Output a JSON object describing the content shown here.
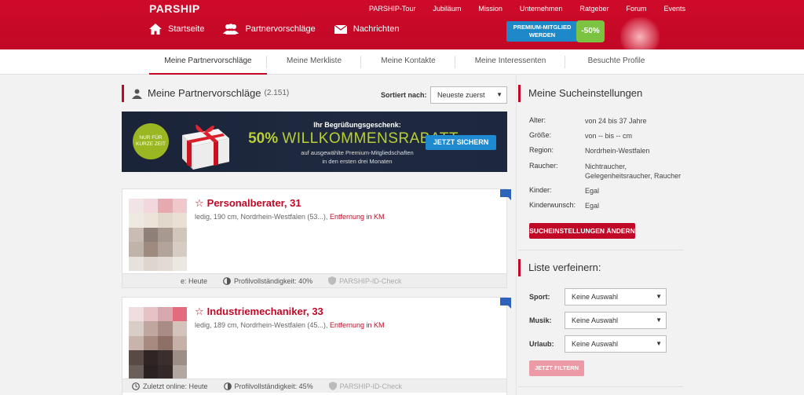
{
  "header": {
    "logo": "PARSHIP",
    "top_links": [
      "PARSHIP-Tour",
      "Jubiläum",
      "Mission",
      "Unternehmen",
      "Ratgeber",
      "Forum",
      "Events"
    ],
    "nav": [
      {
        "label": "Startseite",
        "icon": "home-icon"
      },
      {
        "label": "Partnervorschläge",
        "icon": "people-icon"
      },
      {
        "label": "Nachrichten",
        "icon": "envelope-icon"
      }
    ],
    "premium_line1": "PREMIUM-MITGLIED",
    "premium_line2": "WERDEN",
    "premium_discount": "-50%"
  },
  "subnav": {
    "tabs": [
      "Meine Partnervorschläge",
      "Meine Merkliste",
      "Meine Kontakte",
      "Meine Interessenten",
      "Besuchte Profile"
    ]
  },
  "main": {
    "title": "Meine Partnervorschläge",
    "count": "(2.151)",
    "sort_label": "Sortiert nach:",
    "sort_value": "Neueste zuerst",
    "banner": {
      "badge_line1": "NUR FÜR",
      "badge_line2": "KURZE ZEIT",
      "headline": "Ihr Begrüßungsgeschenk:",
      "percent": "50%",
      "word": "WILLKOMMENSRABATT",
      "sub_line1": "auf ausgewählte Premium-Mitgliedschaften",
      "sub_line2": "in den ersten drei Monaten",
      "button": "JETZT SICHERN"
    },
    "profiles": [
      {
        "name": "Personalberater, 31",
        "details": "ledig, 190 cm, Nordrhein-Westfalen (53...),",
        "distance": "Entfernung in KM",
        "online": "e: Heute",
        "completeness": "Profilvollständigkeit: 40%",
        "id_check": "PARSHIP-ID-Check"
      },
      {
        "name": "Industriemechaniker, 33",
        "details": "ledig, 189 cm, Nordrhein-Westfalen (45...),",
        "distance": "Entfernung in KM",
        "online": "Zuletzt online: Heute",
        "completeness": "Profilvollständigkeit: 45%",
        "id_check": "PARSHIP-ID-Check"
      }
    ]
  },
  "sidebar": {
    "search_title": "Meine Sucheinstellungen",
    "settings": [
      {
        "key": "Alter:",
        "value": "von 24 bis 37 Jahre"
      },
      {
        "key": "Größe:",
        "value": "von -- bis -- cm"
      },
      {
        "key": "Region:",
        "value": "Nordrhein-Westfalen"
      },
      {
        "key": "Raucher:",
        "value": "Nichtraucher, Gelegenheitsraucher, Raucher"
      },
      {
        "key": "Kinder:",
        "value": "Egal"
      },
      {
        "key": "Kinderwunsch:",
        "value": "Egal"
      }
    ],
    "change_button": "SUCHEINSTELLUNGEN ÄNDERN",
    "refine_title": "Liste verfeinern:",
    "filters": [
      {
        "label": "Sport:",
        "value": "Keine Auswahl"
      },
      {
        "label": "Musik:",
        "value": "Keine Auswahl"
      },
      {
        "label": "Urlaub:",
        "value": "Keine Auswahl"
      }
    ],
    "filter_button": "JETZT FILTERN"
  },
  "colors": {
    "brand_red": "#c10826",
    "premium_blue": "#1d89c8",
    "discount_green": "#7cc341",
    "banner_green": "#b9cf33"
  }
}
